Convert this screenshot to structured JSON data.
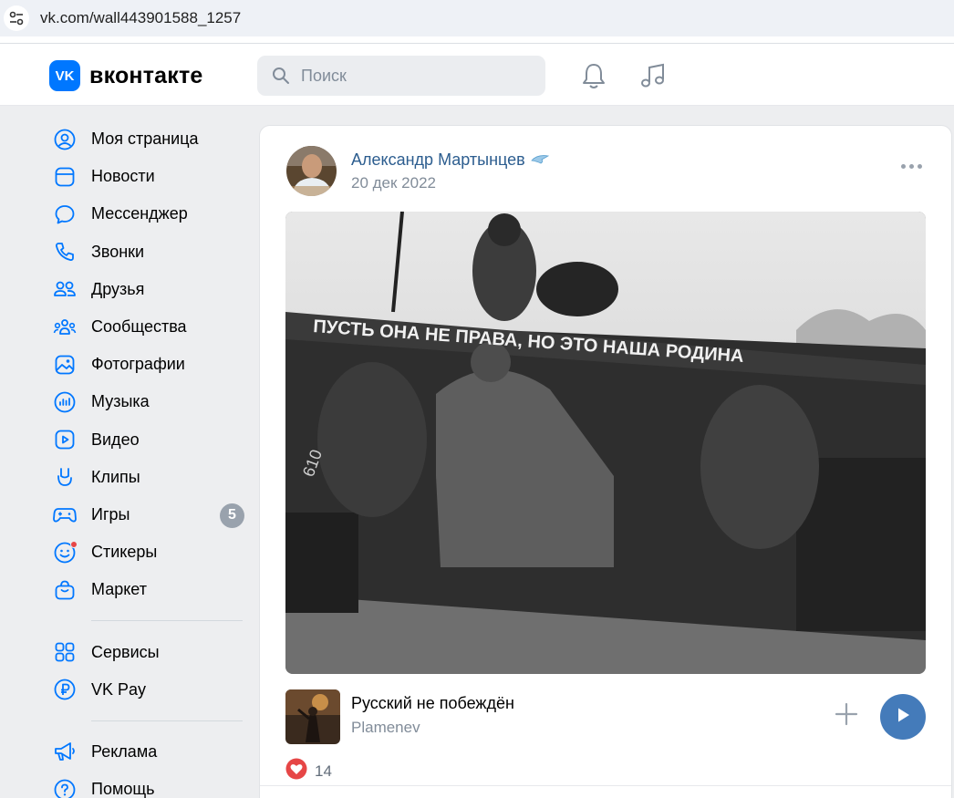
{
  "browser": {
    "url": "vk.com/wall443901588_1257",
    "site_icon": "tune-icon"
  },
  "header": {
    "logo_mark": "VK",
    "logo_text": "вконтакте",
    "search_placeholder": "Поиск",
    "icons": [
      "bell-icon",
      "music-note-icon"
    ],
    "accent_color": "#0077ff"
  },
  "sidebar": {
    "items": [
      {
        "label": "Моя страница",
        "icon": "user-circle-icon"
      },
      {
        "label": "Новости",
        "icon": "news-icon"
      },
      {
        "label": "Мессенджер",
        "icon": "chat-bubble-icon"
      },
      {
        "label": "Звонки",
        "icon": "phone-icon"
      },
      {
        "label": "Друзья",
        "icon": "friends-icon"
      },
      {
        "label": "Сообщества",
        "icon": "communities-icon"
      },
      {
        "label": "Фотографии",
        "icon": "photo-icon"
      },
      {
        "label": "Музыка",
        "icon": "music-icon"
      },
      {
        "label": "Видео",
        "icon": "video-icon"
      },
      {
        "label": "Клипы",
        "icon": "clips-icon"
      },
      {
        "label": "Игры",
        "icon": "gamepad-icon",
        "badge": "5"
      },
      {
        "label": "Стикеры",
        "icon": "sticker-icon"
      },
      {
        "label": "Маркет",
        "icon": "market-bag-icon"
      }
    ],
    "services": [
      {
        "label": "Сервисы",
        "icon": "grid-icon"
      },
      {
        "label": "VK Pay",
        "icon": "ruble-icon"
      }
    ],
    "extra": [
      {
        "label": "Реклама",
        "icon": "megaphone-icon"
      },
      {
        "label": "Помощь",
        "icon": "help-icon"
      }
    ]
  },
  "post": {
    "author": "Александр Мартынцев",
    "date": "20 дек 2022",
    "photo_caption_text": "ПУСТЬ ОНА НЕ ПРАВА, НО ЭТО НАША РОДИНА",
    "audio": {
      "title": "Русский не побеждён",
      "artist": "Plamenev"
    },
    "likes": "14",
    "like_color": "#e64646",
    "play_color": "#447bba"
  }
}
